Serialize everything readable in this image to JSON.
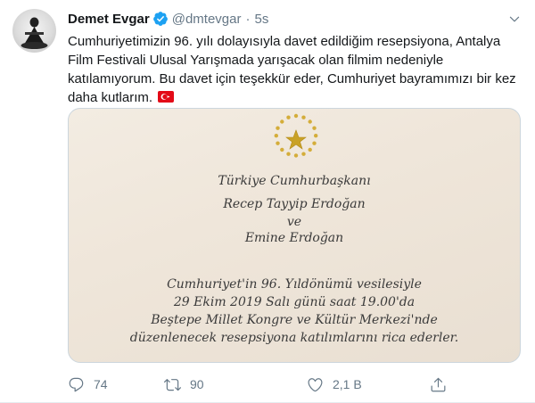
{
  "user": {
    "name": "Demet Evgar",
    "handle": "@dmtevgar",
    "separator": "·",
    "time": "5s"
  },
  "tweet_text": "Cumhuriyetimizin 96. yılı dolayısıyla davet edildiğim resepsiyona, Antalya Film Festivali Ulusal Yarışmada yarışacak olan filmim nedeniyle katılamıyorum. Bu davet için teşekkür eder, Cumhuriyet bayramımızı bir kez daha kutlarım.",
  "invitation": {
    "line1": "Türkiye Cumhurbaşkanı",
    "line2": "Recep Tayyip Erdoğan",
    "line3": "ve",
    "line4": "Emine Erdoğan",
    "line5": "Cumhuriyet'in 96. Yıldönümü vesilesiyle",
    "line6": "29 Ekim 2019 Salı günü saat 19.00'da",
    "line7": "Beştepe Millet Kongre ve Kültür Merkezi'nde",
    "line8": "düzenlenecek resepsiyona katılımlarını rica ederler."
  },
  "actions": {
    "replies": "74",
    "retweets": "90",
    "likes": "2,1 B"
  },
  "icons": {
    "verified": "verified-badge-icon",
    "caret": "chevron-down-icon",
    "flag": "turkey-flag-icon",
    "emblem": "presidential-seal-icon",
    "reply": "reply-icon",
    "retweet": "retweet-icon",
    "like": "heart-icon",
    "share": "share-icon"
  },
  "colors": {
    "accent": "#1da1f2",
    "secondary_text": "#657786",
    "seal_gold": "#c9a227"
  }
}
